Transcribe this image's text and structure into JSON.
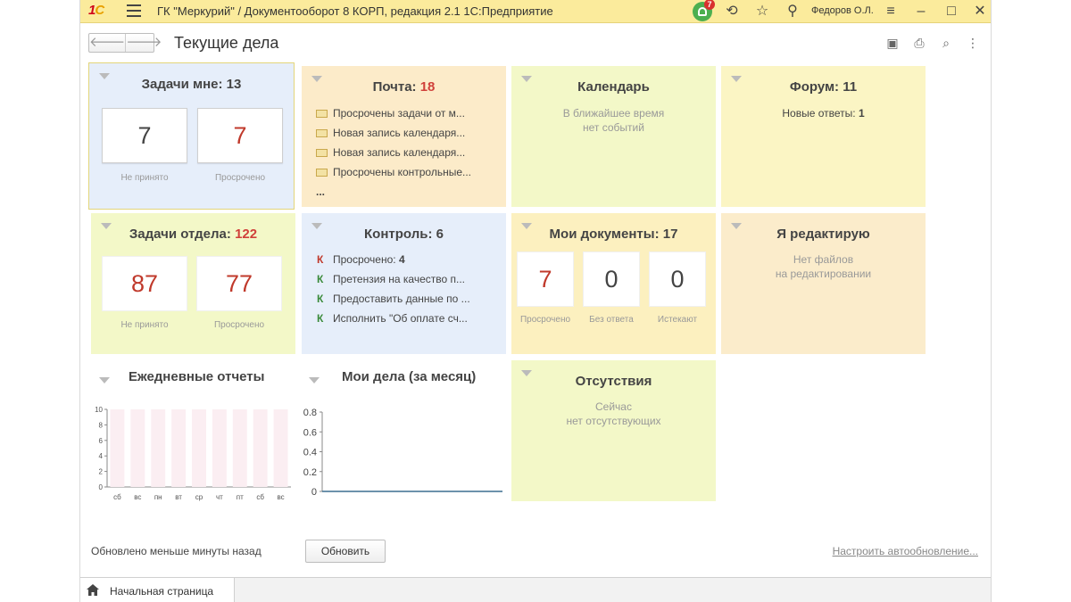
{
  "window": {
    "title": "ГК \"Меркурий\" / Документооборот 8 КОРП, редакция 2.1 1С:Предприятие",
    "user": "Федоров О.Л.",
    "notification_count": "7"
  },
  "toolbar": {
    "page_title": "Текущие дела"
  },
  "tiles": {
    "my_tasks": {
      "title": "Задачи мне:",
      "count": "13",
      "boxes": [
        {
          "value": "7",
          "label": "Не принято"
        },
        {
          "value": "7",
          "label": "Просрочено"
        }
      ]
    },
    "mail": {
      "title": "Почта:",
      "count": "18",
      "items": [
        "Просрочены задачи от м...",
        "Новая запись календаря...",
        "Новая запись календаря...",
        "Просрочены контрольные..."
      ],
      "more": "..."
    },
    "calendar": {
      "title": "Календарь",
      "note1": "В ближайшее время",
      "note2": "нет событий"
    },
    "forum": {
      "title": "Форум:",
      "count": "11",
      "line_label": "Новые ответы:",
      "line_value": "1"
    },
    "dept_tasks": {
      "title": "Задачи отдела:",
      "count": "122",
      "boxes": [
        {
          "value": "87",
          "label": "Не принято"
        },
        {
          "value": "77",
          "label": "Просрочено"
        }
      ]
    },
    "control": {
      "title": "Контроль:",
      "count": "6",
      "marker": "К",
      "items": [
        {
          "text": "Просрочено:",
          "value": "4"
        },
        {
          "text": "Претензия на качество п..."
        },
        {
          "text": "Предоставить данные по ..."
        },
        {
          "text": "Исполнить \"Об оплате сч..."
        }
      ]
    },
    "my_docs": {
      "title": "Мои документы:",
      "count": "17",
      "boxes": [
        {
          "value": "7",
          "label": "Просрочено"
        },
        {
          "value": "0",
          "label": "Без ответа"
        },
        {
          "value": "0",
          "label": "Истекают"
        }
      ]
    },
    "editing": {
      "title": "Я редактирую",
      "note1": "Нет файлов",
      "note2": "на редактировании"
    },
    "absences": {
      "title": "Отсутствия",
      "note1": "Сейчас",
      "note2": "нет отсутствующих"
    }
  },
  "chart_data": [
    {
      "type": "bar",
      "title": "Ежедневные отчеты",
      "categories": [
        "сб",
        "вс",
        "пн",
        "вт",
        "ср",
        "чт",
        "пт",
        "сб",
        "вс"
      ],
      "values": [
        10,
        10,
        10,
        10,
        10,
        10,
        10,
        10,
        10
      ],
      "ylim": [
        0,
        10
      ],
      "yticks": [
        "0",
        "2",
        "4",
        "6",
        "8",
        "10"
      ],
      "bar_color": "#fbeef2"
    },
    {
      "type": "line",
      "title": "Мои дела (за месяц)",
      "values": [
        0,
        0,
        0,
        0,
        0,
        0,
        0,
        0,
        0,
        0,
        0,
        0,
        0,
        0,
        0,
        0,
        0,
        0,
        0,
        0,
        0,
        0,
        0,
        0,
        0,
        0,
        0,
        0,
        0,
        0
      ],
      "ylim": [
        0,
        0.8
      ],
      "yticks": [
        "0",
        "0.2",
        "0.4",
        "0.6",
        "0.8"
      ],
      "line_color": "#3b6e8f"
    }
  ],
  "footer": {
    "status": "Обновлено меньше минуты назад",
    "refresh_label": "Обновить",
    "auto_refresh_link": "Настроить автообновление..."
  },
  "bottom_tab": {
    "label": "Начальная страница"
  },
  "colors": {
    "accent_red": "#d0403a",
    "titlebar": "#fbeb9c"
  }
}
